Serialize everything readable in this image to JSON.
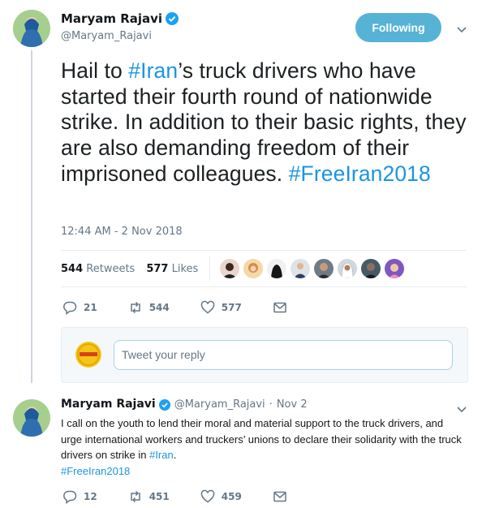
{
  "tweet": {
    "author_name": "Maryam Rajavi",
    "author_handle": "@Maryam_Rajavi",
    "follow_label": "Following",
    "text_parts": {
      "p1": "Hail to ",
      "tag1": "#Iran",
      "p2": "’s truck drivers who have started their fourth round of nationwide strike. In addition to their basic rights, they are also demanding freedom of their imprisoned colleagues. ",
      "tag2": "#FreeIran2018"
    },
    "timestamp": "12:44 AM - 2 Nov 2018",
    "retweets_count": "544",
    "retweets_label": "Retweets",
    "likes_count": "577",
    "likes_label": "Likes",
    "actions": {
      "replies": "21",
      "retweets": "544",
      "likes": "577"
    }
  },
  "reply_box": {
    "placeholder": "Tweet your reply"
  },
  "reply_tweet": {
    "author_name": "Maryam Rajavi",
    "author_handle": "@Maryam_Rajavi",
    "separator": "·",
    "date": "Nov 2",
    "text_parts": {
      "p1": "I call on the youth to lend their moral and material support to the truck drivers, and urge international workers and truckers’ unions to declare their solidarity with the truck drivers on strike in ",
      "tag1": "#Iran",
      "p2": ".",
      "tag2": "#FreeIran2018"
    },
    "actions": {
      "replies": "12",
      "retweets": "451",
      "likes": "459"
    }
  },
  "colors": {
    "accent": "#1b95e0",
    "follow_button": "#56b3d6",
    "verified": "#1da1f2",
    "muted": "#657786"
  }
}
